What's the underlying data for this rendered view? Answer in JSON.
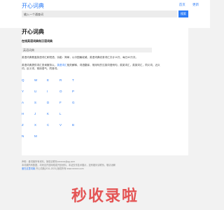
{
  "header": {
    "logo": "开心词典",
    "links": [
      "首页",
      "更新"
    ]
  },
  "search": {
    "placeholder": "输入一个通查词",
    "button_label": "搜索"
  },
  "main": {
    "title": "开心词典",
    "subtitle": "在线英语词典和汉语词典",
    "section_title": "英语词典",
    "para1": "英语词典覆盖英语词汇和短语，功能：简单，以中国最权威，英语词典收录词汇共计10万，每日40万次。",
    "para2_prefix": "英语词典提供词汇查询服务以，",
    "para2_link": "英语词汇",
    "para2_suffix": "相关解释，词语翻译，常用句的汉英词语例句，英英词汇，英英词汇，同义词、近义词，反义词，常用语气，同音词。",
    "letter_rows": [
      [
        "Q",
        "W",
        "E",
        "R",
        "T"
      ],
      [
        "Y",
        "U",
        "I",
        "O",
        "P"
      ],
      [
        "A",
        "S",
        "D",
        "F",
        "G"
      ],
      [
        "H",
        "J",
        "K",
        "L"
      ],
      [
        "Z",
        "X",
        "C",
        "V",
        "B"
      ],
      [
        "N",
        "M"
      ]
    ]
  },
  "footer": {
    "line1": "声明：爱词典所有资料，授权请联系xxxxxxx@qq.com",
    "line2": "本词典所有数据，均来自开放网络或开放资料，本站仅作技术展示，如有疑问请联系，敬请谅解",
    "line3_link": "爱在这里词典",
    "line3_text": "开心词典(2011-2023) 版权所有 www.xxxxxx.com"
  },
  "watermark": "秒收录啦"
}
